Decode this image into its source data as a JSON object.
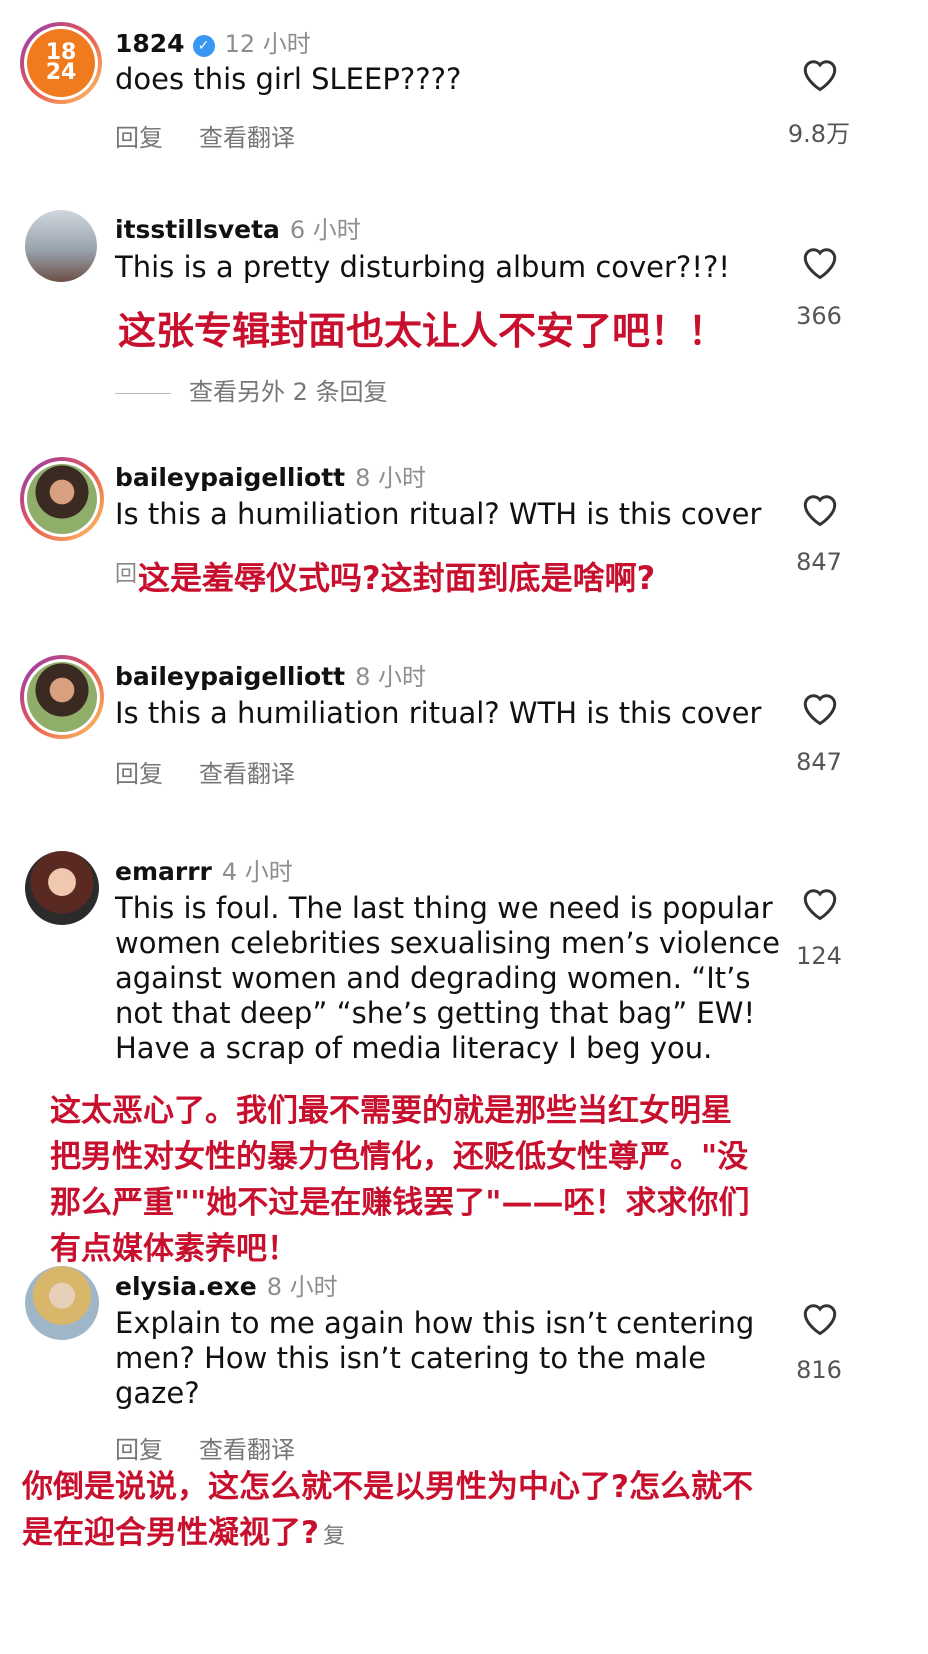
{
  "comments": [
    {
      "username": "1824",
      "time": "12 小时",
      "text": "does this girl SLEEP????",
      "actions": [
        "回复",
        "查看翻译"
      ],
      "likes": "9.8万",
      "avatar_text": "18\n24"
    },
    {
      "username": "itsstillsveta",
      "time": "6 小时",
      "text": "This is a pretty disturbing album cover?!?!",
      "translation": "这张专辑封面也太让人不安了吧！！",
      "likes": "366",
      "more_replies": "查看另外 2 条回复"
    },
    {
      "username": "baileypaigelliott",
      "time": "8 小时",
      "text": "Is this a humiliation ritual? WTH is this cover",
      "translation": "这是羞辱仪式吗?这封面到底是啥啊?",
      "likes": "847",
      "partial_glyph": "回"
    },
    {
      "username": "baileypaigelliott",
      "time": "8 小时",
      "text": "Is this a humiliation ritual? WTH is this cover",
      "actions": [
        "回复",
        "查看翻译"
      ],
      "likes": "847"
    },
    {
      "username": "emarrr",
      "time": "4 小时",
      "text_lines": [
        "This is foul. The last thing we need is popular",
        "women celebrities sexualising men’s violence",
        "against women and degrading women. “It’s",
        "not that deep” “she’s getting that bag” EW!",
        "Have a scrap of media literacy I beg you."
      ],
      "translation_lines": [
        "这太恶心了。我们最不需要的就是那些当红女明星",
        "把男性对女性的暴力色情化，还贬低女性尊严。\"没",
        "那么严重\"\"她不过是在赚钱罢了\"——呸！求求你们",
        "有点媒体素养吧！"
      ],
      "likes": "124"
    },
    {
      "username": "elysia.exe",
      "time": "8 小时",
      "text_lines": [
        "Explain to me again how this isn’t centering",
        "men? How this isn’t catering to the male",
        "gaze?"
      ],
      "actions": [
        "回复",
        "查看翻译"
      ],
      "translation_lines": [
        "你倒是说说，这怎么就不是以男性为中心了?怎么就不",
        "是在迎合男性凝视了?"
      ],
      "trailing_glyph": "复",
      "likes": "816"
    }
  ],
  "icons": {
    "heart": "heart-outline-icon",
    "verified": "verified-badge-icon"
  },
  "colors": {
    "translation_red": "#c8102e",
    "meta_gray": "#8e8e8e",
    "verified_blue": "#3897f0"
  }
}
